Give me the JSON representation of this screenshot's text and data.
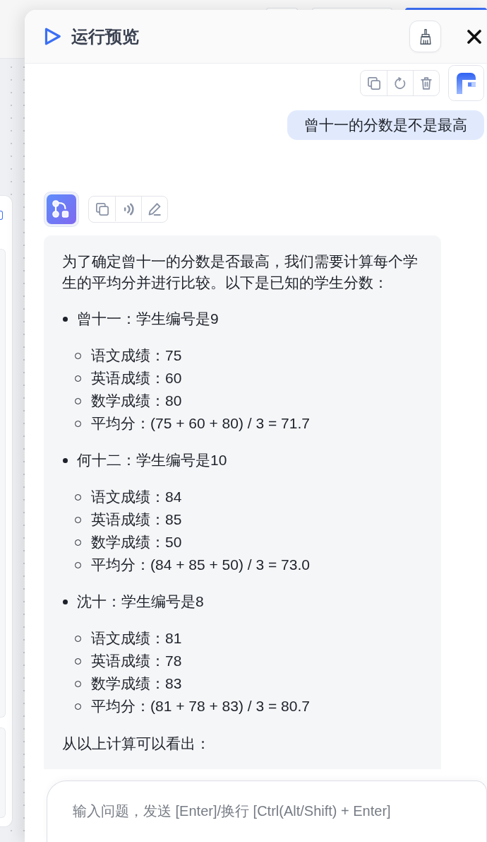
{
  "header": {
    "title": "运行预览"
  },
  "user_message": {
    "text": "曾十一的分数是不是最高"
  },
  "answer": {
    "blocks": [
      {
        "kind": "paragraph",
        "text": "为了确定曾十一的分数是否最高，我们需要计算每个学生的平均分并进行比较。以下是已知的学生分数："
      },
      {
        "kind": "list",
        "items": [
          {
            "text": "曾十一：学生编号是9",
            "children": [
              {
                "text": "语文成绩：75"
              },
              {
                "text": "英语成绩：60"
              },
              {
                "text": "数学成绩：80"
              },
              {
                "text": "平均分：(75 + 60 + 80) / 3 = 71.7"
              }
            ]
          },
          {
            "text": "何十二：学生编号是10",
            "children": [
              {
                "text": "语文成绩：84"
              },
              {
                "text": "英语成绩：85"
              },
              {
                "text": "数学成绩：50"
              },
              {
                "text": "平均分：(84 + 85 + 50) / 3 = 73.0"
              }
            ]
          },
          {
            "text": "沈十：学生编号是8",
            "children": [
              {
                "text": "语文成绩：81"
              },
              {
                "text": "英语成绩：78"
              },
              {
                "text": "数学成绩：83"
              },
              {
                "text": "平均分：(81 + 78 + 83) / 3 = 80.7"
              }
            ]
          }
        ]
      },
      {
        "kind": "paragraph",
        "text": "从以上计算可以看出："
      }
    ]
  },
  "input": {
    "placeholder": "输入问题，发送 [Enter]/换行 [Ctrl(Alt/Shift) + Enter]"
  }
}
